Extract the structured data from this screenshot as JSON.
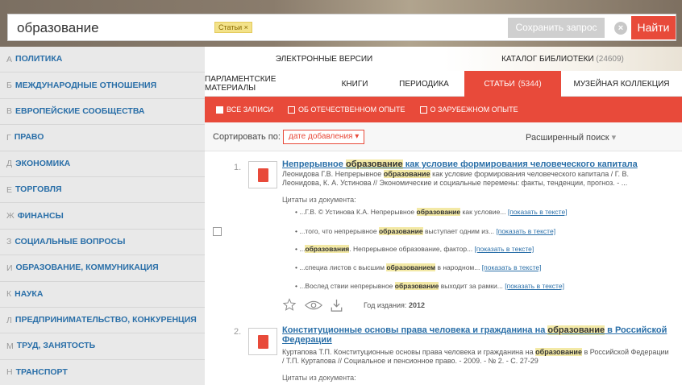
{
  "search": {
    "query": "образование",
    "filter_tag": "Статьи ×",
    "save_label": "Сохранить запрос",
    "find_label": "Найти"
  },
  "sidebar": {
    "items": [
      {
        "letter": "А",
        "label": "Политика"
      },
      {
        "letter": "Б",
        "label": "Международные отношения"
      },
      {
        "letter": "В",
        "label": "Европейские сообщества"
      },
      {
        "letter": "Г",
        "label": "Право"
      },
      {
        "letter": "Д",
        "label": "Экономика"
      },
      {
        "letter": "Е",
        "label": "Торговля"
      },
      {
        "letter": "Ж",
        "label": "Финансы"
      },
      {
        "letter": "З",
        "label": "Социальные вопросы"
      },
      {
        "letter": "И",
        "label": "Образование, коммуникация"
      },
      {
        "letter": "К",
        "label": "Наука"
      },
      {
        "letter": "Л",
        "label": "Предпринимательство, конкуренция"
      },
      {
        "letter": "М",
        "label": "Труд, занятость"
      },
      {
        "letter": "Н",
        "label": "Транспорт"
      }
    ]
  },
  "tabs_primary": [
    {
      "label": "ЭЛЕКТРОННЫЕ ВЕРСИИ",
      "count": ""
    },
    {
      "label": "КАТАЛОГ БИБЛИОТЕКИ",
      "count": "(24609)"
    }
  ],
  "tabs_secondary": [
    {
      "label": "Парламентские материалы",
      "count": ""
    },
    {
      "label": "Книги",
      "count": ""
    },
    {
      "label": "Периодика",
      "count": ""
    },
    {
      "label": "Статьи",
      "count": "(5344)"
    },
    {
      "label": "Музейная коллекция",
      "count": ""
    }
  ],
  "filters": [
    {
      "label": "ВСЕ ЗАПИСИ",
      "checked": true
    },
    {
      "label": "ОБ ОТЕЧЕСТВЕННОМ ОПЫТЕ",
      "checked": false
    },
    {
      "label": "О ЗАРУБЕЖНОМ ОПЫТЕ",
      "checked": false
    }
  ],
  "sort": {
    "label": "Сортировать по:",
    "value": "дате добавления",
    "advanced": "Расширенный поиск"
  },
  "results": [
    {
      "num": "1.",
      "title_pre": "Непрерывное ",
      "title_hl": "образование",
      "title_post": " как условие формирования человеческого капитала",
      "desc_pre": "Леонидова Г.В. Непрерывное ",
      "desc_hl": "образование",
      "desc_post": " как условие формирования человеческого капитала / Г. В. Леонидова, К. А. Устинова // Экономические и социальные перемены: факты, тенденции, прогноз. - ...",
      "cite_head": "Цитаты из документа:",
      "cites": [
        {
          "pre": "...Г.В. © Устинова К.А. Непрерывное ",
          "hl": "образование",
          "post": " как условие...",
          "link": "[показать в тексте]"
        },
        {
          "pre": "...того, что непрерывное ",
          "hl": "образование",
          "post": " выступает одним из...",
          "link": "[показать в тексте]"
        },
        {
          "pre": "...",
          "hl": "образования",
          "post": ". Непрерывное образование, фактор...",
          "link": "[показать в тексте]"
        },
        {
          "pre": "...специа листов с высшим ",
          "hl": "образованием",
          "post": " в народном...",
          "link": "[показать в тексте]"
        },
        {
          "pre": "...Вослед ствии непрерывное ",
          "hl": "образование",
          "post": " выходит за рамки...",
          "link": "[показать в тексте]"
        }
      ],
      "year_label": "Год издания:",
      "year": "2012"
    },
    {
      "num": "2.",
      "title_pre": "Конституционные основы права человека и гражданина на ",
      "title_hl": "образование",
      "title_post": " в Российской Федерации",
      "desc_pre": "Куртапова Т.П. Конституционные основы права человека и гражданина на ",
      "desc_hl": "образование",
      "desc_post": " в Российской Федерации / Т.П. Куртапова // Социальное и пенсионное право. - 2009. - № 2. - С. 27-29",
      "cite_head": "Цитаты из документа:"
    }
  ],
  "colors": {
    "accent": "#e84a3a",
    "link": "#2a6fa8",
    "highlight": "#f3e9a6"
  }
}
